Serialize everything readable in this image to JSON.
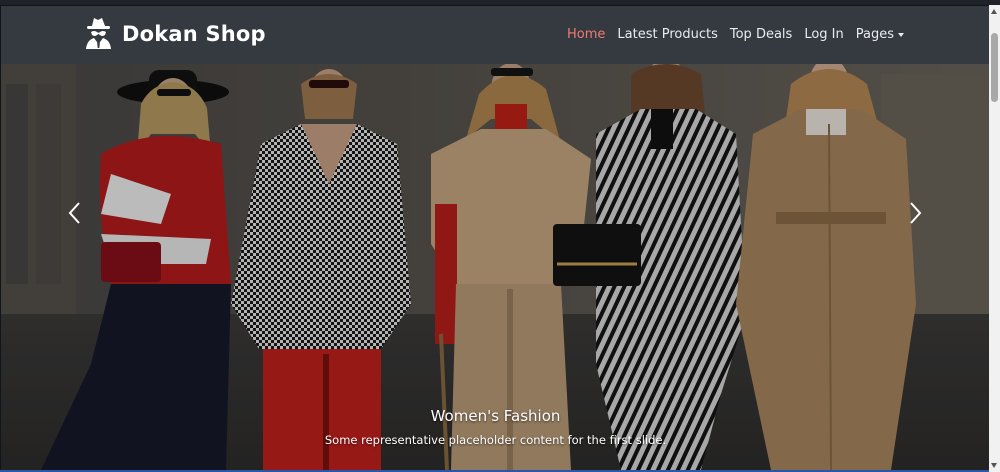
{
  "navbar": {
    "brand": "Dokan Shop",
    "links": [
      {
        "label": "Home",
        "active": true
      },
      {
        "label": "Latest Products",
        "active": false
      },
      {
        "label": "Top Deals",
        "active": false
      },
      {
        "label": "Log In",
        "active": false
      },
      {
        "label": "Pages",
        "active": false,
        "dropdown": true
      }
    ]
  },
  "carousel": {
    "caption_title": "Women's Fashion",
    "caption_text": "Some representative placeholder content for the first slide.",
    "prev_icon": "chevron-left-icon",
    "next_icon": "chevron-right-icon"
  },
  "colors": {
    "navbar_bg": "#343a40",
    "active_link": "#f17a70",
    "link": "#e9ecef"
  }
}
